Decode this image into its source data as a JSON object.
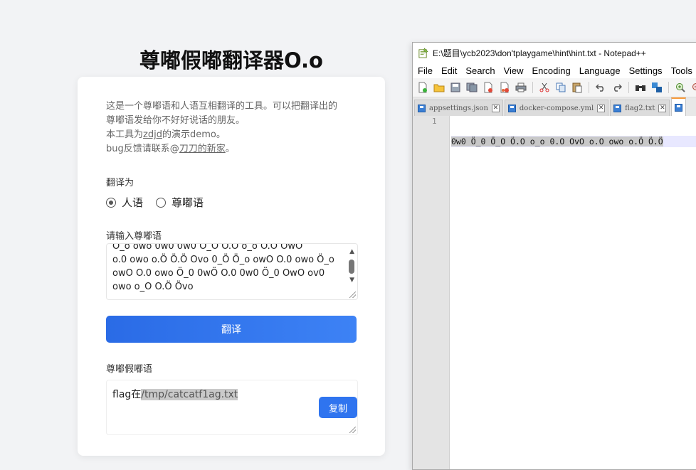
{
  "app": {
    "title": "尊嘟假嘟翻译器O.o",
    "intro": {
      "line1": "这是一个尊嘟语和人语互相翻译的工具。可以把翻译出的",
      "line2": "尊嘟语发给你不好好说话的朋友。",
      "line3_prefix": "本工具为",
      "line3_link": "zdjd",
      "line3_suffix": "的演示demo。",
      "line4_prefix": "bug反馈请联系@",
      "line4_link": "刀刀的新家",
      "line4_suffix": "。"
    },
    "translate_to_label": "翻译为",
    "options": [
      {
        "label": "人语",
        "checked": true
      },
      {
        "label": "尊嘟语",
        "checked": false
      }
    ],
    "input_label": "请输入尊嘟语",
    "input_value": "Ö_o owo 0w0 0w0 Ö_O Ö.O o_o O.O OwO\no.0 owo o.Ö Ö.Ö Ovo 0_Ö Ö_o owO O.0 owo Ö_o\nowO O.0 owo Ö_0 0wÖ O.0 0w0 Ö_0 OwO ov0\nowo o_O O.Ö Övo",
    "translate_button": "翻译",
    "output_label": "尊嘟假嘟语",
    "output_prefix": "flag在",
    "output_highlight": "/tmp/catcatf1ag.txt",
    "copy_button": "复制"
  },
  "notepad": {
    "title": "E:\\题目\\ycb2023\\don'tplaygame\\hint\\hint.txt - Notepad++",
    "menus": [
      "File",
      "Edit",
      "Search",
      "View",
      "Encoding",
      "Language",
      "Settings",
      "Tools"
    ],
    "tabs": [
      {
        "label": "appsettings.json"
      },
      {
        "label": "docker-compose.yml"
      },
      {
        "label": "flag2.txt"
      }
    ],
    "line_number": "1",
    "line_text": "0w0 Ö_0 Ö_O Ö.O o_o 0.O OvO o.O owo o.Ö Ö.Ö"
  }
}
